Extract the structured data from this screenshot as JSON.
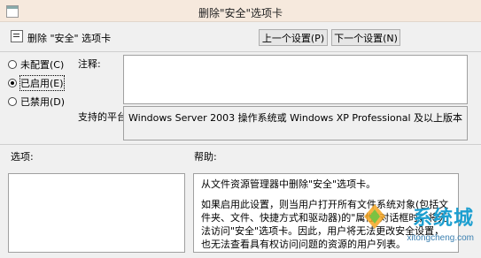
{
  "window": {
    "title": "删除\"安全\"选项卡"
  },
  "header": {
    "policy_name": "删除 \"安全\" 选项卡",
    "prev_button": "上一个设置(P)",
    "next_button": "下一个设置(N)"
  },
  "state": {
    "options": [
      {
        "label": "未配置(C)",
        "checked": false
      },
      {
        "label": "已启用(E)",
        "checked": true
      },
      {
        "label": "已禁用(D)",
        "checked": false
      }
    ]
  },
  "comment": {
    "label": "注释:",
    "value": ""
  },
  "platform": {
    "label": "支持的平台:",
    "value": "Windows Server 2003 操作系统或 Windows XP Professional 及以上版本"
  },
  "options_panel": {
    "label": "选项:"
  },
  "help": {
    "label": "帮助:",
    "paragraph1": "从文件资源管理器中删除\"安全\"选项卡。",
    "paragraph2": "如果启用此设置，则当用户打开所有文件系统对象(包括文件夹、文件、快捷方式和驱动器)的\"属性\"对话框时，将无法访问\"安全\"选项卡。因此，用户将无法更改安全设置，也无法查看具有权访问问题的资源的用户列表。"
  },
  "watermark": {
    "brand": "系统城",
    "url": "xitongcheng.com"
  }
}
